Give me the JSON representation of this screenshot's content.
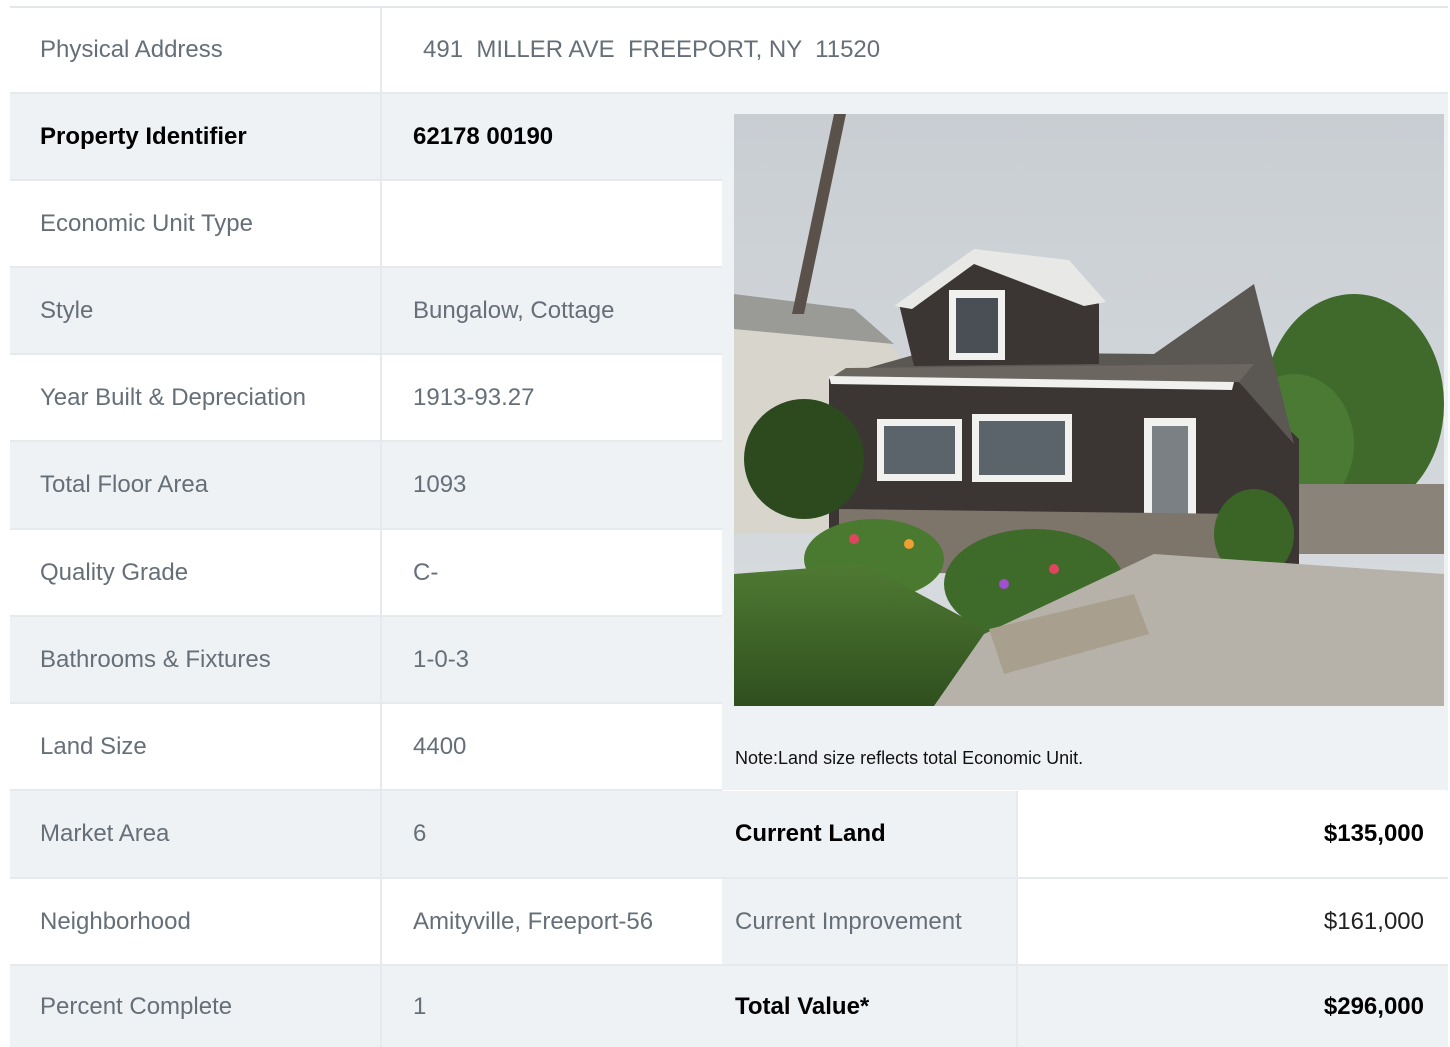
{
  "address": {
    "label": "Physical Address",
    "value": "491  MILLER AVE  FREEPORT, NY  11520"
  },
  "details": [
    {
      "label": "Property Identifier",
      "value": "62178  00190"
    },
    {
      "label": "Economic Unit Type",
      "value": ""
    },
    {
      "label": "Style",
      "value": "Bungalow, Cottage"
    },
    {
      "label": "Year Built & Depreciation",
      "value": "1913-93.27"
    },
    {
      "label": "Total Floor Area",
      "value": "1093"
    },
    {
      "label": "Quality Grade",
      "value": "C-"
    },
    {
      "label": "Bathrooms & Fixtures",
      "value": "1-0-3"
    },
    {
      "label": "Land Size",
      "value": "4400"
    },
    {
      "label": "Market Area",
      "value": "6"
    },
    {
      "label": "Neighborhood",
      "value": "Amityville, Freeport-56"
    },
    {
      "label": "Percent Complete",
      "value": "1"
    }
  ],
  "note": "Note:Land size reflects total Economic Unit.",
  "valuation": [
    {
      "label": "Current Land",
      "value": "$135,000"
    },
    {
      "label": "Current Improvement",
      "value": "$161,000"
    },
    {
      "label": "Total Value*",
      "value": "$296,000"
    }
  ],
  "colors": {
    "alt_row": "#eef2f5",
    "label_text": "#666f78",
    "strong_text": "#000000",
    "border": "#e6eaee"
  }
}
